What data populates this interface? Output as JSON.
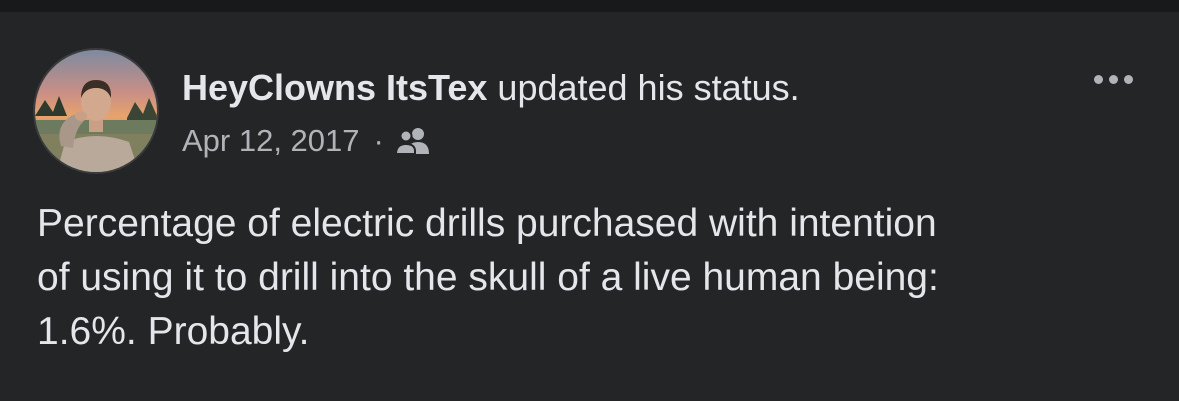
{
  "post": {
    "author": "HeyClowns ItsTex",
    "action": " updated his status.",
    "date": "Apr 12, 2017",
    "separator": "·",
    "audience_icon": "friends-icon",
    "more_icon": "more-options-icon",
    "text": "Percentage of electric drills purchased with intention\nof using it to drill into the skull of a live human being:\n1.6%. Probably."
  },
  "colors": {
    "background": "#242526",
    "topbar": "#18191a",
    "primary_text": "#e4e6eb",
    "secondary_text": "#b0b3b8"
  }
}
